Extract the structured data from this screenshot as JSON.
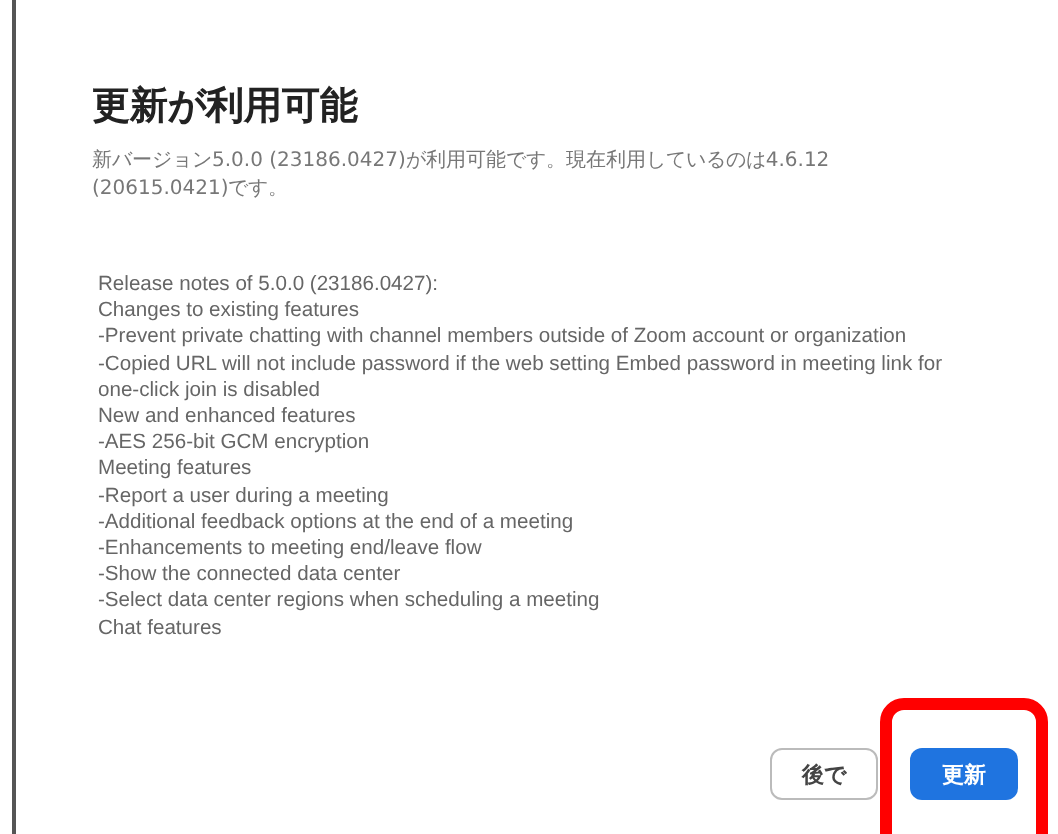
{
  "dialog": {
    "title": "更新が利用可能",
    "message": "新バージョン5.0.0 (23186.0427)が利用可能です。現在利用しているのは4.6.12 (20615.0421)です。",
    "release_notes": [
      "Release notes of 5.0.0 (23186.0427):",
      "Changes to existing features",
      "-Prevent private chatting with channel members outside of Zoom account or organization",
      "-Copied URL will not include password if the web setting Embed password in meeting link for one-click join is disabled",
      "New and enhanced features",
      "-AES 256-bit GCM encryption",
      "Meeting features",
      "-Report a user during a meeting",
      "-Additional feedback options at the end of a meeting",
      "-Enhancements to meeting end/leave flow",
      "-Show the connected data center",
      "-Select data center regions when scheduling a meeting",
      "Chat features"
    ],
    "buttons": [
      {
        "label": "後で",
        "kind": "secondary"
      },
      {
        "label": "更新",
        "kind": "primary",
        "highlighted": true
      }
    ]
  }
}
